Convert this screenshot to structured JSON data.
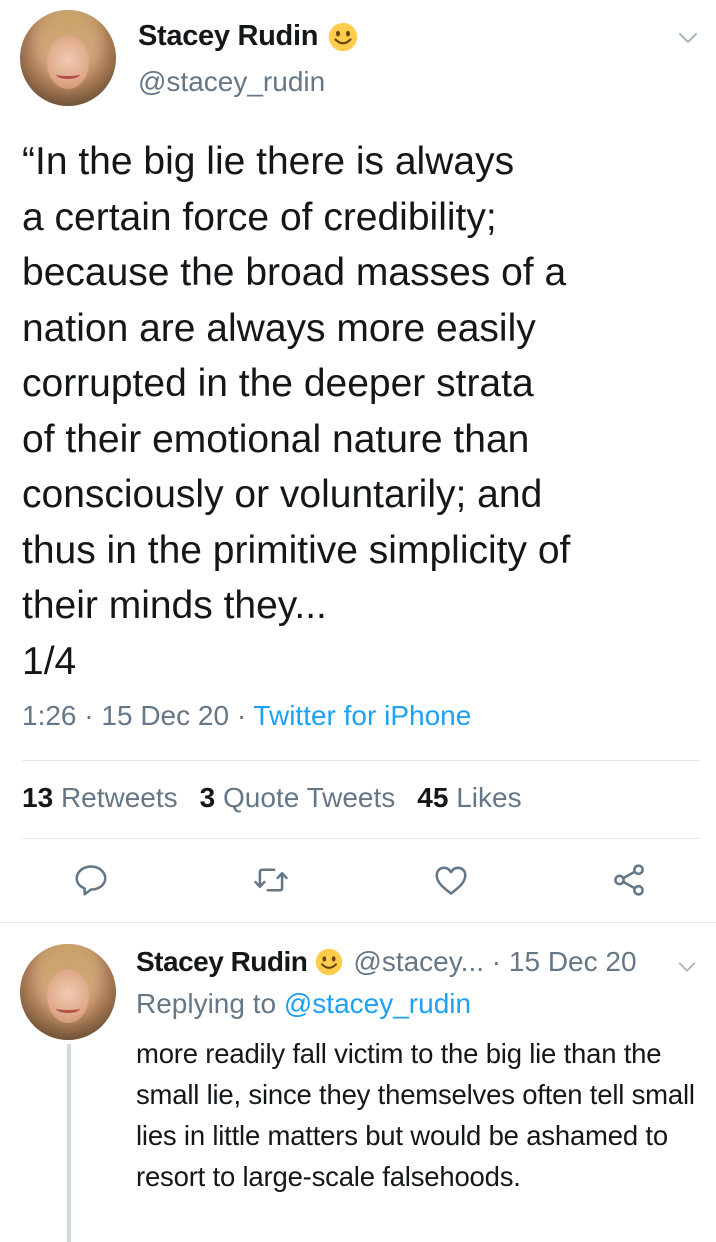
{
  "main_tweet": {
    "display_name": "Stacey Rudin",
    "handle": "@stacey_rudin",
    "text": "“In the big lie there is always\na certain force of credibility;\nbecause the broad masses of a\nnation are always more easily\ncorrupted in the deeper strata\nof their emotional nature than\nconsciously or voluntarily; and\nthus in the primitive simplicity of\ntheir minds they...\n1/4",
    "time": "1:26",
    "date": "15 Dec 20",
    "source": "Twitter for iPhone",
    "retweets_count": "13",
    "retweets_label": "Retweets",
    "quote_count": "3",
    "quote_label": "Quote Tweets",
    "likes_count": "45",
    "likes_label": "Likes"
  },
  "reply_tweet": {
    "display_name": "Stacey Rudin",
    "handle": "@stacey...",
    "date": "15 Dec 20",
    "replying_prefix": "Replying to",
    "replying_to": "@stacey_rudin",
    "text": "more readily fall victim to the big lie than the small lie, since they themselves often tell small lies in little matters but would be ashamed to resort to large-scale falsehoods."
  },
  "icons": {
    "verified_emoji": "smiley-face-icon",
    "menu": "chevron-down-icon",
    "reply": "comment-icon",
    "retweet": "retweet-icon",
    "like": "heart-icon",
    "share": "share-icon"
  },
  "colors": {
    "text": "#14171a",
    "secondary": "#657786",
    "link": "#1da1f2",
    "divider": "#e1e8ed",
    "emoji_fill": "#ffcc4d"
  }
}
